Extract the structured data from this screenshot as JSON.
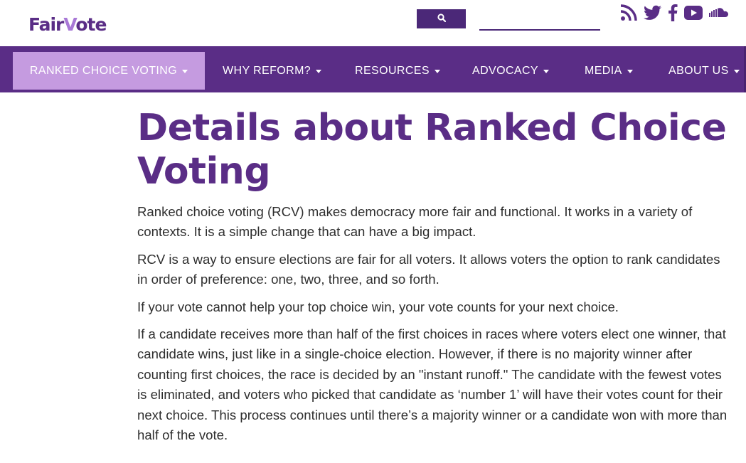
{
  "header": {
    "logo_prefix": "Fair",
    "logo_v": "V",
    "logo_suffix": "ote",
    "search_placeholder": "",
    "search_value": "",
    "social_icons": [
      "rss-icon",
      "twitter-icon",
      "facebook-icon",
      "youtube-icon",
      "soundcloud-icon"
    ]
  },
  "nav": {
    "items": [
      {
        "label": "RANKED CHOICE VOTING",
        "active": true
      },
      {
        "label": "WHY REFORM?",
        "active": false
      },
      {
        "label": "RESOURCES",
        "active": false
      },
      {
        "label": "ADVOCACY",
        "active": false
      },
      {
        "label": "MEDIA",
        "active": false
      },
      {
        "label": "ABOUT US",
        "active": false
      }
    ]
  },
  "main": {
    "title": "Details about Ranked Choice Voting",
    "paragraphs": [
      "Ranked choice voting (RCV) makes democracy more fair and functional. It works in a variety of contexts. It is a simple change that can have a big impact.",
      "RCV is a way to ensure elections are fair for all voters. It allows voters the option to rank candidates in order of preference: one, two, three, and so forth.",
      "If your vote cannot help your top choice win, your vote counts for your next choice.",
      "If a candidate receives more than half of the first choices in races where voters elect one winner, that candidate wins, just like in a single-choice election. However, if there is no majority winner after counting first choices, the race is decided by an \"instant runoff.\" The candidate with the fewest votes is eliminated, and voters who picked that candidate as ‘number 1’ will have their votes count for their next choice. This process continues until there’s a majority winner or a candidate won with more than half of the vote."
    ]
  },
  "colors": {
    "brand_purple": "#5a2d86",
    "active_nav": "#c59be0",
    "search_button": "#4b2878",
    "logo_accent": "#a878d6"
  }
}
